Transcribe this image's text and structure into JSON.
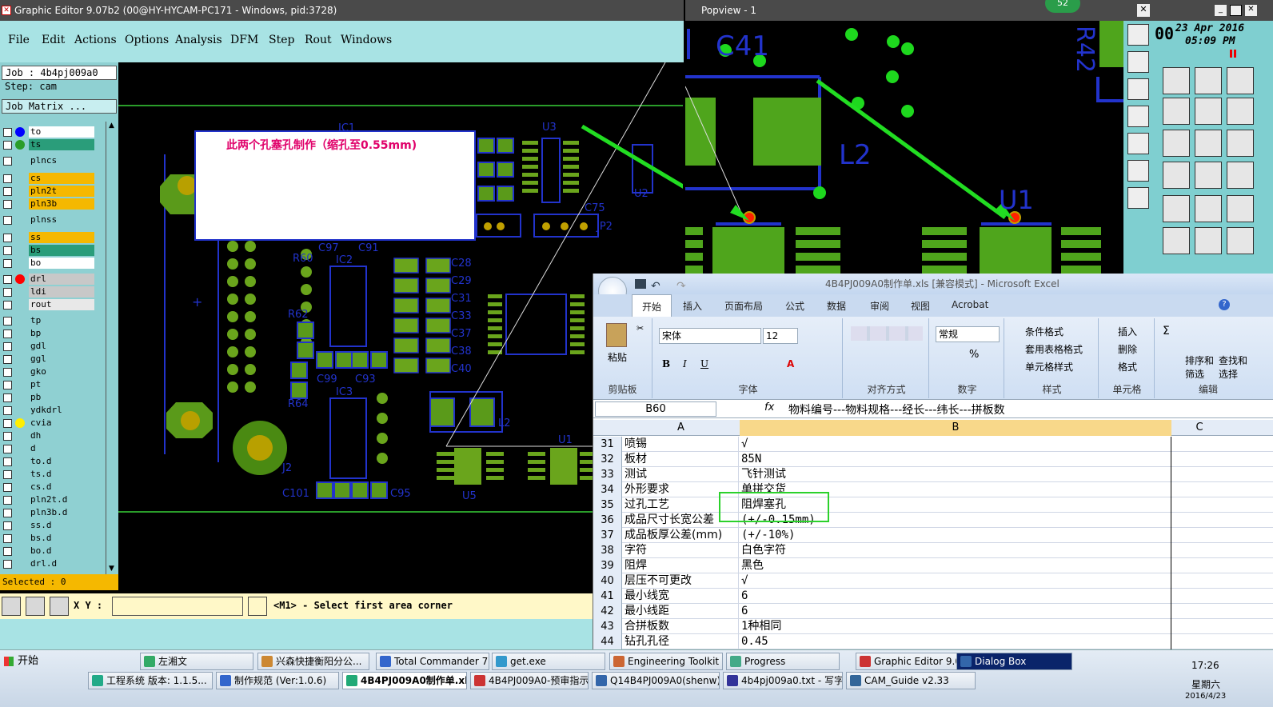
{
  "graphic_editor": {
    "title": "Graphic Editor 9.07b2 (00@HY-HYCAM-PC171 - Windows, pid:3728)",
    "menu": [
      "File",
      "Edit",
      "Actions",
      "Options",
      "Analysis",
      "DFM",
      "Step",
      "Rout",
      "Windows"
    ],
    "job_label": "Job : 4b4pj009a0",
    "step_label": "Step: cam",
    "job_matrix_label": "Job Matrix ...",
    "layers": [
      {
        "name": "to",
        "bg": "#ffffff",
        "dot": "#0000ff"
      },
      {
        "name": "ts",
        "bg": "#2a9d7a",
        "dot": "#2a9d2a"
      },
      {
        "name": "plncs",
        "bg": "#8fd0d2",
        "dot": ""
      },
      {
        "name": "cs",
        "bg": "#f5b800",
        "dot": ""
      },
      {
        "name": "pln2t",
        "bg": "#f5b800",
        "dot": ""
      },
      {
        "name": "pln3b",
        "bg": "#f5b800",
        "dot": ""
      },
      {
        "name": "plnss",
        "bg": "#8fd0d2",
        "dot": ""
      },
      {
        "name": "ss",
        "bg": "#f5b800",
        "dot": ""
      },
      {
        "name": "bs",
        "bg": "#2a9d7a",
        "dot": ""
      },
      {
        "name": "bo",
        "bg": "#ffffff",
        "dot": ""
      },
      {
        "name": "drl",
        "bg": "#c8c8c8",
        "dot": "#ff0000"
      },
      {
        "name": "ldi",
        "bg": "#c8c8c8",
        "dot": ""
      },
      {
        "name": "rout",
        "bg": "#e8e8e8",
        "dot": ""
      },
      {
        "name": "tp",
        "bg": "#8fd0d2",
        "dot": ""
      },
      {
        "name": "bp",
        "bg": "#8fd0d2",
        "dot": ""
      },
      {
        "name": "gdl",
        "bg": "#8fd0d2",
        "dot": ""
      },
      {
        "name": "ggl",
        "bg": "#8fd0d2",
        "dot": ""
      },
      {
        "name": "gko",
        "bg": "#8fd0d2",
        "dot": ""
      },
      {
        "name": "pt",
        "bg": "#8fd0d2",
        "dot": ""
      },
      {
        "name": "pb",
        "bg": "#8fd0d2",
        "dot": ""
      },
      {
        "name": "ydkdrl",
        "bg": "#8fd0d2",
        "dot": ""
      },
      {
        "name": "cvia",
        "bg": "#8fd0d2",
        "dot": "#ffee00"
      },
      {
        "name": "dh",
        "bg": "#8fd0d2",
        "dot": ""
      },
      {
        "name": "d",
        "bg": "#8fd0d2",
        "dot": ""
      },
      {
        "name": "to.d",
        "bg": "#8fd0d2",
        "dot": ""
      },
      {
        "name": "ts.d",
        "bg": "#8fd0d2",
        "dot": ""
      },
      {
        "name": "cs.d",
        "bg": "#8fd0d2",
        "dot": ""
      },
      {
        "name": "pln2t.d",
        "bg": "#8fd0d2",
        "dot": ""
      },
      {
        "name": "pln3b.d",
        "bg": "#8fd0d2",
        "dot": ""
      },
      {
        "name": "ss.d",
        "bg": "#8fd0d2",
        "dot": ""
      },
      {
        "name": "bs.d",
        "bg": "#8fd0d2",
        "dot": ""
      },
      {
        "name": "bo.d",
        "bg": "#8fd0d2",
        "dot": ""
      },
      {
        "name": "drl.d",
        "bg": "#8fd0d2",
        "dot": ""
      }
    ],
    "selected_label": "Selected : 0",
    "xy_label": "X Y :",
    "status_message": "<M1> - Select first area corner",
    "annotation_text": "此两个孔塞孔制作（缩孔至0.55mm)",
    "canvas_labels": [
      "IC1",
      "U3",
      "U2",
      "C75",
      "JP2",
      "C97",
      "C91",
      "R60",
      "IC2",
      "C28",
      "C29",
      "C31",
      "C33",
      "C37",
      "C38",
      "C40",
      "R62",
      "C99",
      "C93",
      "IC3",
      "R64",
      "L2",
      "U1",
      "U5",
      "C101",
      "C95",
      "J2"
    ]
  },
  "popview": {
    "title": "Popview - 1",
    "badge": "52",
    "labels": [
      "C41",
      "R42",
      "L2",
      "U1"
    ]
  },
  "right_panel": {
    "date": "23 Apr 2016",
    "time": "05:09 PM",
    "prefix": "00"
  },
  "excel": {
    "title": "4B4PJ009A0制作单.xls  [兼容模式] - Microsoft Excel",
    "tabs": [
      "开始",
      "插入",
      "页面布局",
      "公式",
      "数据",
      "审阅",
      "视图",
      "Acrobat"
    ],
    "groups": [
      "剪贴板",
      "字体",
      "对齐方式",
      "数字",
      "样式",
      "单元格",
      "编辑"
    ],
    "paste_label": "粘贴",
    "font_name": "宋体",
    "font_size": "12",
    "number_format": "常规",
    "style_items": [
      "条件格式",
      "套用表格格式",
      "单元格样式"
    ],
    "cell_items": [
      "插入",
      "删除",
      "格式"
    ],
    "edit_items": [
      "排序和筛选",
      "查找和选择"
    ],
    "name_box": "B60",
    "fx": "fx",
    "formula": "物料编号---物料规格---经长---纬长---拼板数",
    "columns": [
      "A",
      "B",
      "C"
    ],
    "rows": [
      {
        "n": "31",
        "a": "喷锡",
        "b": "√"
      },
      {
        "n": "32",
        "a": "板材",
        "b": "85N"
      },
      {
        "n": "33",
        "a": "测试",
        "b": "飞针测试"
      },
      {
        "n": "34",
        "a": "外形要求",
        "b": "单拼交货"
      },
      {
        "n": "35",
        "a": "过孔工艺",
        "b": "阻焊塞孔"
      },
      {
        "n": "36",
        "a": "成品尺寸长宽公差",
        "b": "(+/-0.15mm)"
      },
      {
        "n": "37",
        "a": "成品板厚公差(mm)",
        "b": "(+/-10%)"
      },
      {
        "n": "38",
        "a": "字符",
        "b": "白色字符"
      },
      {
        "n": "39",
        "a": "阻焊",
        "b": "黑色"
      },
      {
        "n": "40",
        "a": "层压不可更改",
        "b": "√"
      },
      {
        "n": "41",
        "a": "最小线宽",
        "b": "6"
      },
      {
        "n": "42",
        "a": "最小线距",
        "b": "6"
      },
      {
        "n": "43",
        "a": "合拼板数",
        "b": "1种相同"
      },
      {
        "n": "44",
        "a": "钻孔孔径",
        "b": "0.45"
      }
    ]
  },
  "taskbar": {
    "start": "开始",
    "row1": [
      "左湘文",
      "兴森快捷衡阳分公...",
      "Total Commander 7.0 ...",
      "get.exe",
      "Engineering Toolkit 9....",
      "Progress",
      "Graphic Editor 9.07b2 ...",
      "Dialog Box"
    ],
    "row2": [
      "工程系统  版本: 1.1.5...",
      "制作规范 (Ver:1.0.6)",
      "4B4PJ009A0制作单.xl...",
      "4B4PJ009A0-预审指示...",
      "Q14B4PJ009A0(shenw)2...",
      "4b4pj009a0.txt - 写字板",
      "CAM_Guide v2.33"
    ],
    "clock": "17:26",
    "weekday": "星期六",
    "date": "2016/4/23"
  }
}
